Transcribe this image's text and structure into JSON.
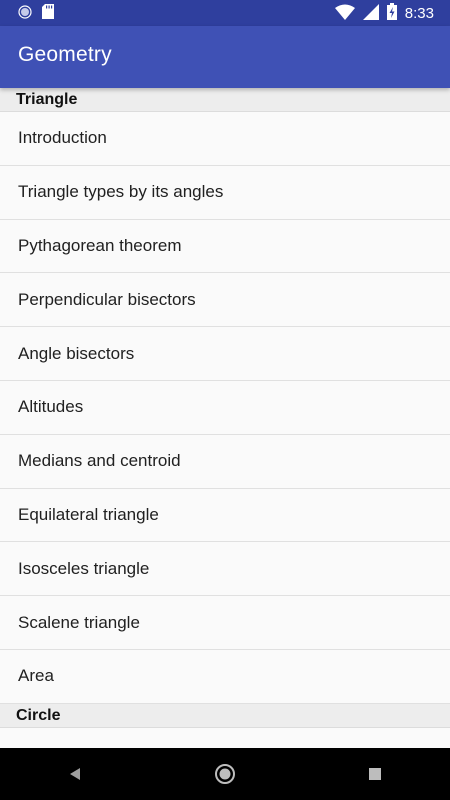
{
  "status_bar": {
    "time": "8:33",
    "icons": [
      "circle-notification-icon",
      "sd-card-icon",
      "wifi-icon",
      "cell-signal-icon",
      "battery-charging-icon"
    ]
  },
  "app_bar": {
    "title": "Geometry",
    "color": "#3f51b5"
  },
  "sections": [
    {
      "header": "Triangle",
      "items": [
        "Introduction",
        "Triangle types by its angles",
        "Pythagorean theorem",
        "Perpendicular bisectors",
        "Angle bisectors",
        "Altitudes",
        "Medians and centroid",
        "Equilateral triangle",
        "Isosceles triangle",
        "Scalene triangle",
        "Area"
      ]
    },
    {
      "header": "Circle",
      "items": []
    }
  ],
  "nav_bar": {
    "icons": [
      "back-icon",
      "home-icon",
      "recents-icon"
    ]
  }
}
